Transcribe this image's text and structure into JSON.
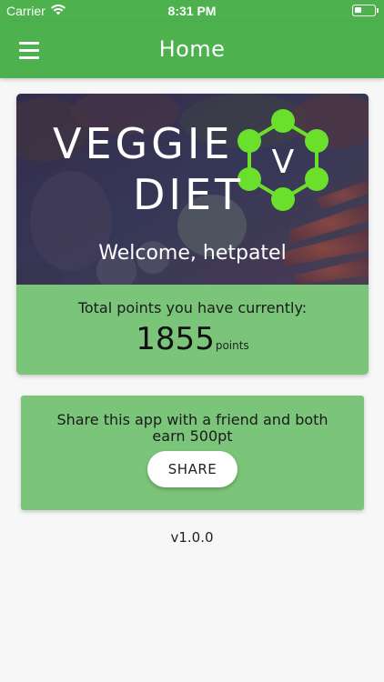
{
  "status_bar": {
    "carrier": "Carrier",
    "time": "8:31 PM",
    "icons": [
      "wifi-icon",
      "battery-icon"
    ]
  },
  "header": {
    "title": "Home",
    "menu_icon": "hamburger-menu-icon"
  },
  "hero": {
    "logo_line1": "VEGGIE",
    "logo_line2": "DIET",
    "logo_badge_letter": "V",
    "welcome": "Welcome, hetpatel"
  },
  "points": {
    "caption": "Total points you have currently:",
    "value": "1855",
    "unit": "points"
  },
  "share": {
    "text": "Share this app with a friend and both earn 500pt",
    "button_label": "SHARE"
  },
  "footer": {
    "version": "v1.0.0"
  },
  "colors": {
    "primary": "#4db24e",
    "card": "#7bc57a",
    "badge": "#6be02c",
    "background": "#f7f7f7"
  }
}
